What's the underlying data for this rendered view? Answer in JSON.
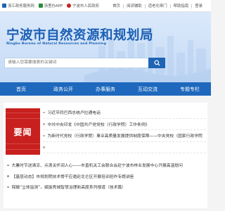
{
  "topbar": {
    "left_links": [
      {
        "label": "浙江政务服务网",
        "icon": "gov-service-icon",
        "color": "#1e64b4"
      },
      {
        "label": "浙里办APP",
        "icon": "mobile-app-icon",
        "color": "#2b8a3e"
      },
      {
        "label": "宁波市人民政府",
        "icon": "city-gov-icon",
        "color": "#c8201e"
      }
    ],
    "right_links": [
      "首页",
      "阅读辅助",
      "适老化専门",
      "帮助指南",
      "登录"
    ]
  },
  "header": {
    "title": "宁波市自然资源和规划局",
    "subtitle": "Ningbo Bureau of Natural Resources and Planning",
    "search_placeholder": "请输入您需要搜索的关键词",
    "search_icon": "search-icon",
    "title_color": "#1a5fb4"
  },
  "nav": {
    "items": [
      "首页",
      "政务公开",
      "办事服务",
      "互动交流",
      "专题专栏"
    ],
    "color": "#1e68bd"
  },
  "news": {
    "badge": "要闻",
    "badge_color": "#c8201e",
    "headlines": [
      "习近平同巴西总统卢拉通电话",
      "中共中央印发《中国共产党党校（行政学院）工作条例》",
      "为新时代党校（行政学院）事业高质量发展提供制度保障——中央党校（国家行政学院",
      ""
    ],
    "list": [
      "大暑时节送清凉、点滴关怀润人心——市直机关工会联合会赴宁波市林业发展中心开展高温慰问",
      "【基层动态】市规划院技术骨干应邀赴北仑区开展培训班作专题讲座",
      "探输“立体监测”，赋能秀城智慧治理新高度系列报道（技术篇）"
    ]
  }
}
